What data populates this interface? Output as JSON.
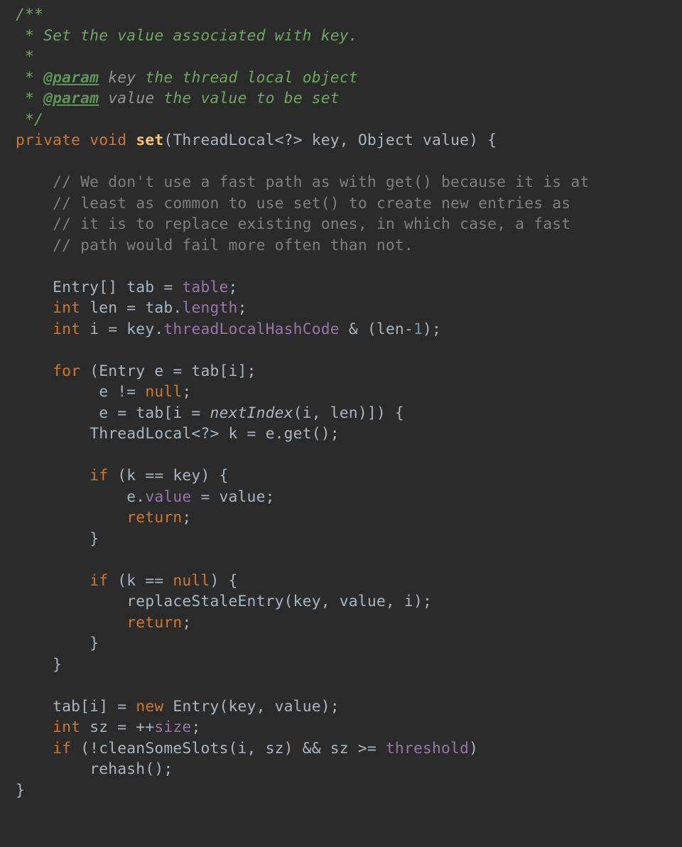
{
  "javadoc": {
    "open": "/**",
    "line1": " * Set the value associated with key.",
    "blank": " *",
    "tag": "@param",
    "p1_name": "key",
    "p1_desc": "the thread local object",
    "p2_name": "value",
    "p2_desc": "the value to be set",
    "close": " */"
  },
  "sig": {
    "mod": "private",
    "ret": "void",
    "name": "set",
    "params": "(ThreadLocal<?> key, Object value) {"
  },
  "block1": {
    "c1": "// We don't use a fast path as with get() because it is at",
    "c2": "// least as common to use set() to create new entries as",
    "c3": "// it is to replace existing ones, in which case, a fast",
    "c4": "// path would fail more often than not."
  },
  "decl": {
    "entry_type": "Entry[] tab = ",
    "table_field": "table",
    "semi": ";",
    "int_kw": "int",
    "len_decl": " len = tab.",
    "length_field": "length",
    "i_decl": " i = key.",
    "hash_field": "threadLocalHashCode",
    "mask": " & (len-",
    "one": "1",
    "mask_close": ");"
  },
  "loop": {
    "for_kw": "for",
    "for_head": " (Entry e = tab[i];",
    "cond_pre": "     e != ",
    "null_kw": "null",
    "cond_post": ";",
    "upd_pre": "     e = tab[i = ",
    "nextIndex": "nextIndex",
    "upd_post": "(i, len)]) {",
    "k_decl": "ThreadLocal<?> k = e.get();"
  },
  "if1": {
    "if_kw": "if",
    "cond": " (k == key) {",
    "body1a": "e.",
    "value_field": "value",
    "body1b": " = value;",
    "ret": "return",
    "semi": ";",
    "close": "}"
  },
  "if2": {
    "if_kw": "if",
    "cond_pre": " (k == ",
    "null_kw": "null",
    "cond_post": ") {",
    "call": "replaceStaleEntry(key, value, i);",
    "ret": "return",
    "semi": ";",
    "close": "}"
  },
  "loop_close": "}",
  "tail": {
    "l1a": "tab[i] = ",
    "new_kw": "new",
    "l1b": " Entry(key, value);",
    "int_kw": "int",
    "sz_decl": " sz = ++",
    "size_field": "size",
    "semi": ";",
    "if_kw": "if",
    "cond_pre": " (!cleanSomeSlots(i, sz) && sz >= ",
    "threshold_field": "threshold",
    "cond_post": ")",
    "rehash": "rehash();"
  },
  "method_close": "}"
}
